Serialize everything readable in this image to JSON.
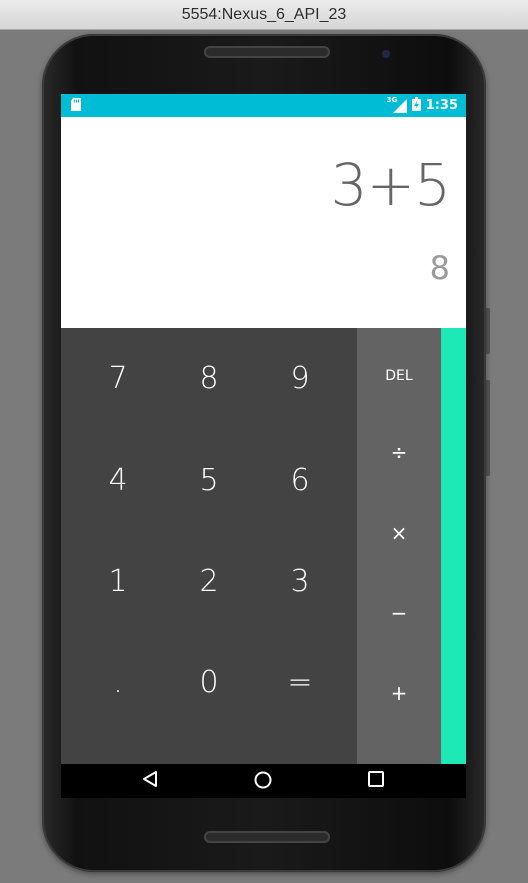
{
  "window": {
    "title": "5554:Nexus_6_API_23"
  },
  "statusbar": {
    "network": "3G",
    "time": "1:35"
  },
  "display": {
    "formula": "3+5",
    "result": "8"
  },
  "keypad": {
    "rows": [
      [
        "7",
        "8",
        "9"
      ],
      [
        "4",
        "5",
        "6"
      ],
      [
        "1",
        "2",
        "3"
      ],
      [
        ".",
        "0",
        "="
      ]
    ]
  },
  "operators": {
    "del": "DEL",
    "divide": "÷",
    "multiply": "×",
    "minus": "−",
    "plus": "+"
  },
  "colors": {
    "status": "#00bcd4",
    "accent": "#1de9b6",
    "pad": "#434343",
    "ops": "#636363"
  },
  "nav": {
    "icons": [
      "back-icon",
      "home-icon",
      "recents-icon"
    ]
  }
}
